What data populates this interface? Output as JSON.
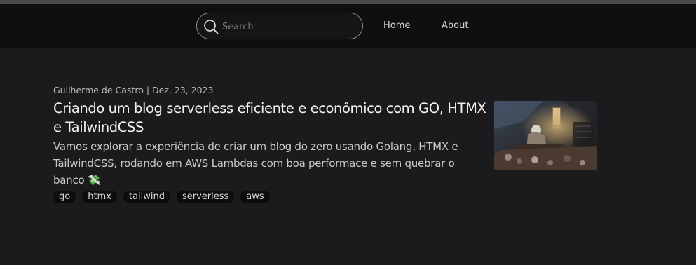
{
  "nav": {
    "search_placeholder": "Search",
    "links": [
      "Home",
      "About"
    ]
  },
  "post": {
    "meta": "Guilherme de Castro | Dez, 23, 2023",
    "title": "Criando um blog serverless eficiente e econômico com GO, HTMX e TailwindCSS",
    "excerpt": "Vamos explorar a experiência de criar um blog do zero usando Golang, HTMX e TailwindCSS, rodando em AWS Lambdas com boa performace e sem quebrar o banco 💸",
    "tags": [
      "go",
      "htmx",
      "tailwind",
      "serverless",
      "aws"
    ]
  },
  "colors": {
    "background": "#1b1b1d",
    "navbar": "#0f0f10",
    "tag_bg": "#0c0c0d"
  }
}
